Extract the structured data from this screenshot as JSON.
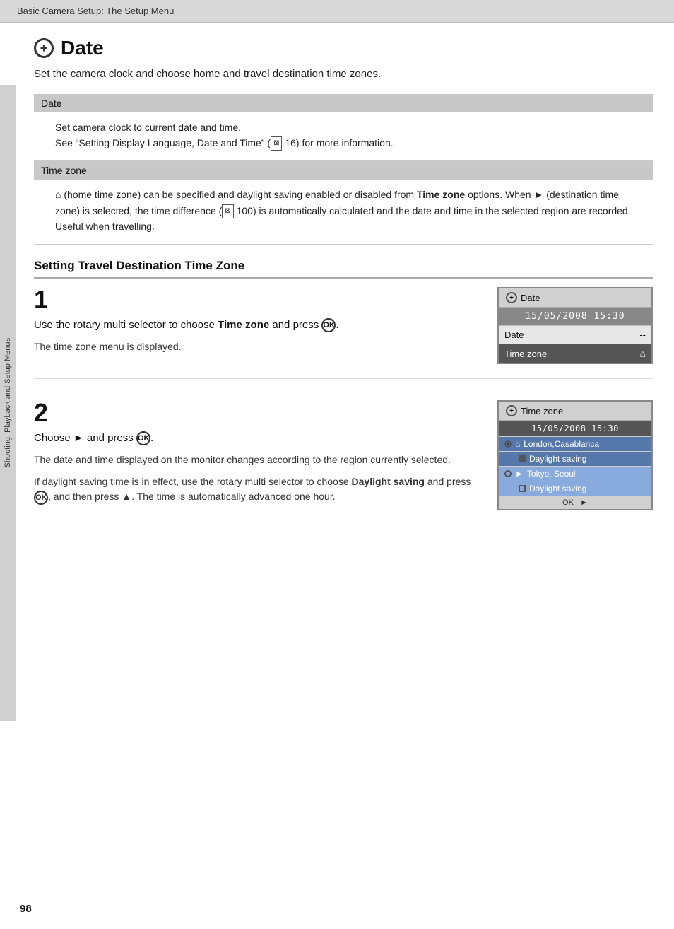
{
  "header": {
    "label": "Basic Camera Setup: The Setup Menu"
  },
  "sidebar": {
    "label": "Shooting, Playback and Setup Menus"
  },
  "page_title": {
    "icon_label": "+",
    "title": "Date"
  },
  "subtitle": "Set the camera clock and choose home and travel destination time zones.",
  "sections": {
    "date": {
      "header": "Date",
      "body_line1": "Set camera clock to current date and time.",
      "body_line2": "See “Setting Display Language, Date and Time” (",
      "body_ref": "16",
      "body_line2_end": ") for more information."
    },
    "time_zone": {
      "header": "Time zone",
      "body": "(home time zone) can be specified and daylight saving enabled or disabled from ",
      "bold1": "Time zone",
      "body2": " options. When ",
      "dest": "►",
      "body3": " (destination time zone) is selected, the time difference (",
      "ref2": "100",
      "body4": ") is automatically calculated and the date and time in the selected region are recorded. Useful when travelling."
    }
  },
  "travel_section": {
    "heading": "Setting Travel Destination Time Zone",
    "steps": [
      {
        "number": "1",
        "instruction_start": "Use the rotary multi selector to choose ",
        "instruction_bold": "Time zone",
        "instruction_end": " and press ",
        "ok_symbol": "OK",
        "note": "The time zone menu is displayed.",
        "screen": {
          "header": "Date",
          "date_time": "15/05/2008  15:30",
          "row1_label": "Date",
          "row1_value": "--",
          "row2_label": "Time zone",
          "row2_icon": "⌂"
        }
      },
      {
        "number": "2",
        "instruction_start": "Choose ",
        "dest_arrow": "►",
        "instruction_mid": " and press ",
        "ok_symbol": "OK",
        "instruction_end": ".",
        "note1": "The date and time displayed on the monitor changes according to the region currently selected.",
        "note2_start": "If daylight saving time is in effect, use the rotary multi selector to choose ",
        "note2_bold": "Daylight saving",
        "note2_mid": " and press ",
        "note2_ok": "OK",
        "note2_end": ", and then press ▲. The time is automatically advanced one hour.",
        "screen": {
          "header": "Time zone",
          "date_time": "15/05/2008  15:30",
          "row1_radio": "filled",
          "row1_home_icon": "⌂",
          "row1_label": "London,Casablanca",
          "row1_check": "checked",
          "row1_check_label": "Daylight saving",
          "row2_radio": "empty",
          "row2_dest": "►",
          "row2_label": "Tokyo, Seoul",
          "row2_check2": "unchecked",
          "row2_check2_label": "Daylight saving",
          "footer": "OK : ►"
        }
      }
    ]
  },
  "page_number": "98"
}
